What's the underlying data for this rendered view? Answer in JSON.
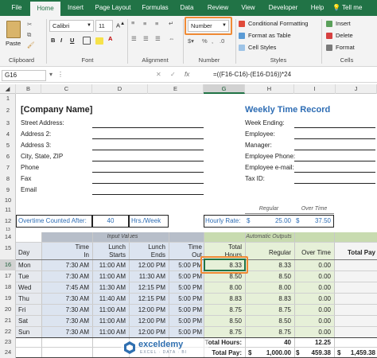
{
  "ribbon_tabs": {
    "file": "File",
    "items": [
      "Home",
      "Insert",
      "Page Layout",
      "Formulas",
      "Data",
      "Review",
      "View",
      "Developer",
      "Help"
    ],
    "tellme": "Tell me"
  },
  "ribbon": {
    "paste": "Paste",
    "font_name": "Calibri",
    "font_size": "11",
    "number_format": "Number",
    "conditional_formatting": "Conditional Formatting",
    "format_as_table": "Format as Table",
    "cell_styles": "Cell Styles",
    "insert": "Insert",
    "delete": "Delete",
    "format": "Format",
    "groups": [
      "Clipboard",
      "Font",
      "Alignment",
      "Number",
      "Styles",
      "Cells"
    ],
    "bold": "B",
    "italic": "I",
    "underline": "U",
    "percent": "%",
    "fx": "fx"
  },
  "formula_bar": {
    "name_box": "G16",
    "formula": "=((F16-C16)-(E16-D16))*24"
  },
  "columns": [
    "A",
    "B",
    "C",
    "D",
    "E",
    "F",
    "G",
    "H",
    "I",
    "J"
  ],
  "selected_column": "G",
  "rows": [
    "1",
    "2",
    "3",
    "4",
    "5",
    "6",
    "7",
    "8",
    "9",
    "10",
    "11",
    "12",
    "13",
    "14",
    "15",
    "16",
    "17",
    "18",
    "19",
    "20",
    "21",
    "22",
    "23",
    "24"
  ],
  "selected_row": "16",
  "sheet": {
    "company_name": "[Company Name]",
    "address_labels": [
      "Street Address:",
      "Address 2:",
      "Address 3:",
      "City, State, ZIP",
      "Phone",
      "Fax",
      "Email"
    ],
    "title": "Weekly Time Record",
    "employee_labels": [
      "Week Ending:",
      "Employee:",
      "Manager:",
      "Employee Phone:",
      "Employee e-mail:",
      "Tax ID:"
    ],
    "regular_header": "Regular",
    "overtime_header": "Over Time",
    "hourly_rate_label": "Hourly Rate:",
    "currency": "$",
    "rate_regular": "25.00",
    "rate_overtime": "37.50",
    "overtime_after_label": "Overtime Counted After:",
    "overtime_after_value": "40",
    "overtime_after_unit": "Hrs./Week",
    "input_values_label": "Input Values",
    "automatic_outputs_label": "Automatic Outputs",
    "headers": {
      "day": "Day",
      "time_in": [
        "Time",
        "In"
      ],
      "lunch_starts": [
        "Lunch",
        "Starts"
      ],
      "lunch_ends": [
        "Lunch",
        "Ends"
      ],
      "time_out": [
        "Time",
        "Out"
      ],
      "total_hours": [
        "Total",
        "Hours"
      ],
      "regular": "Regular",
      "over_time": "Over Time",
      "total_pay": "Total Pay"
    },
    "time_rows": [
      {
        "day": "Mon",
        "in": "7:30 AM",
        "ls": "11:00 AM",
        "le": "12:00 PM",
        "out": "5:00 PM",
        "total": "8.33",
        "regular": "8.33",
        "ot": "0.00"
      },
      {
        "day": "Tue",
        "in": "7:30 AM",
        "ls": "11:00 AM",
        "le": "11:30 AM",
        "out": "5:00 PM",
        "total": "8.50",
        "regular": "8.50",
        "ot": "0.00"
      },
      {
        "day": "Wed",
        "in": "7:45 AM",
        "ls": "11:30 AM",
        "le": "12:15 PM",
        "out": "5:00 PM",
        "total": "8.00",
        "regular": "8.00",
        "ot": "0.00"
      },
      {
        "day": "Thu",
        "in": "7:30 AM",
        "ls": "11:40 AM",
        "le": "12:15 PM",
        "out": "5:00 PM",
        "total": "8.83",
        "regular": "8.83",
        "ot": "0.00"
      },
      {
        "day": "Fri",
        "in": "7:30 AM",
        "ls": "11:00 AM",
        "le": "12:00 PM",
        "out": "5:00 PM",
        "total": "8.75",
        "regular": "8.75",
        "ot": "0.00"
      },
      {
        "day": "Sat",
        "in": "7:30 AM",
        "ls": "11:00 AM",
        "le": "12:00 PM",
        "out": "5:00 PM",
        "total": "8.50",
        "regular": "8.50",
        "ot": "0.00"
      },
      {
        "day": "Sun",
        "in": "7:30 AM",
        "ls": "11:00 AM",
        "le": "12:00 PM",
        "out": "5:00 PM",
        "total": "8.75",
        "regular": "8.75",
        "ot": "0.00"
      }
    ],
    "total_hours_label": "Total Hours:",
    "total_hours_regular": "40",
    "total_hours_ot": "12.25",
    "total_pay_label": "Total Pay:",
    "total_pay_regular": "1,000.00",
    "total_pay_ot": "459.38",
    "total_pay_all": "1,459.38"
  },
  "watermark": {
    "brand": "exceldemy",
    "tagline": "EXCEL · DATA · BI"
  },
  "colors": {
    "excel_green": "#217346",
    "title_blue": "#2e6db4",
    "highlight_orange": "#ef8a35",
    "input_fill": "#dce4f0",
    "output_fill": "#e6f0d8"
  }
}
